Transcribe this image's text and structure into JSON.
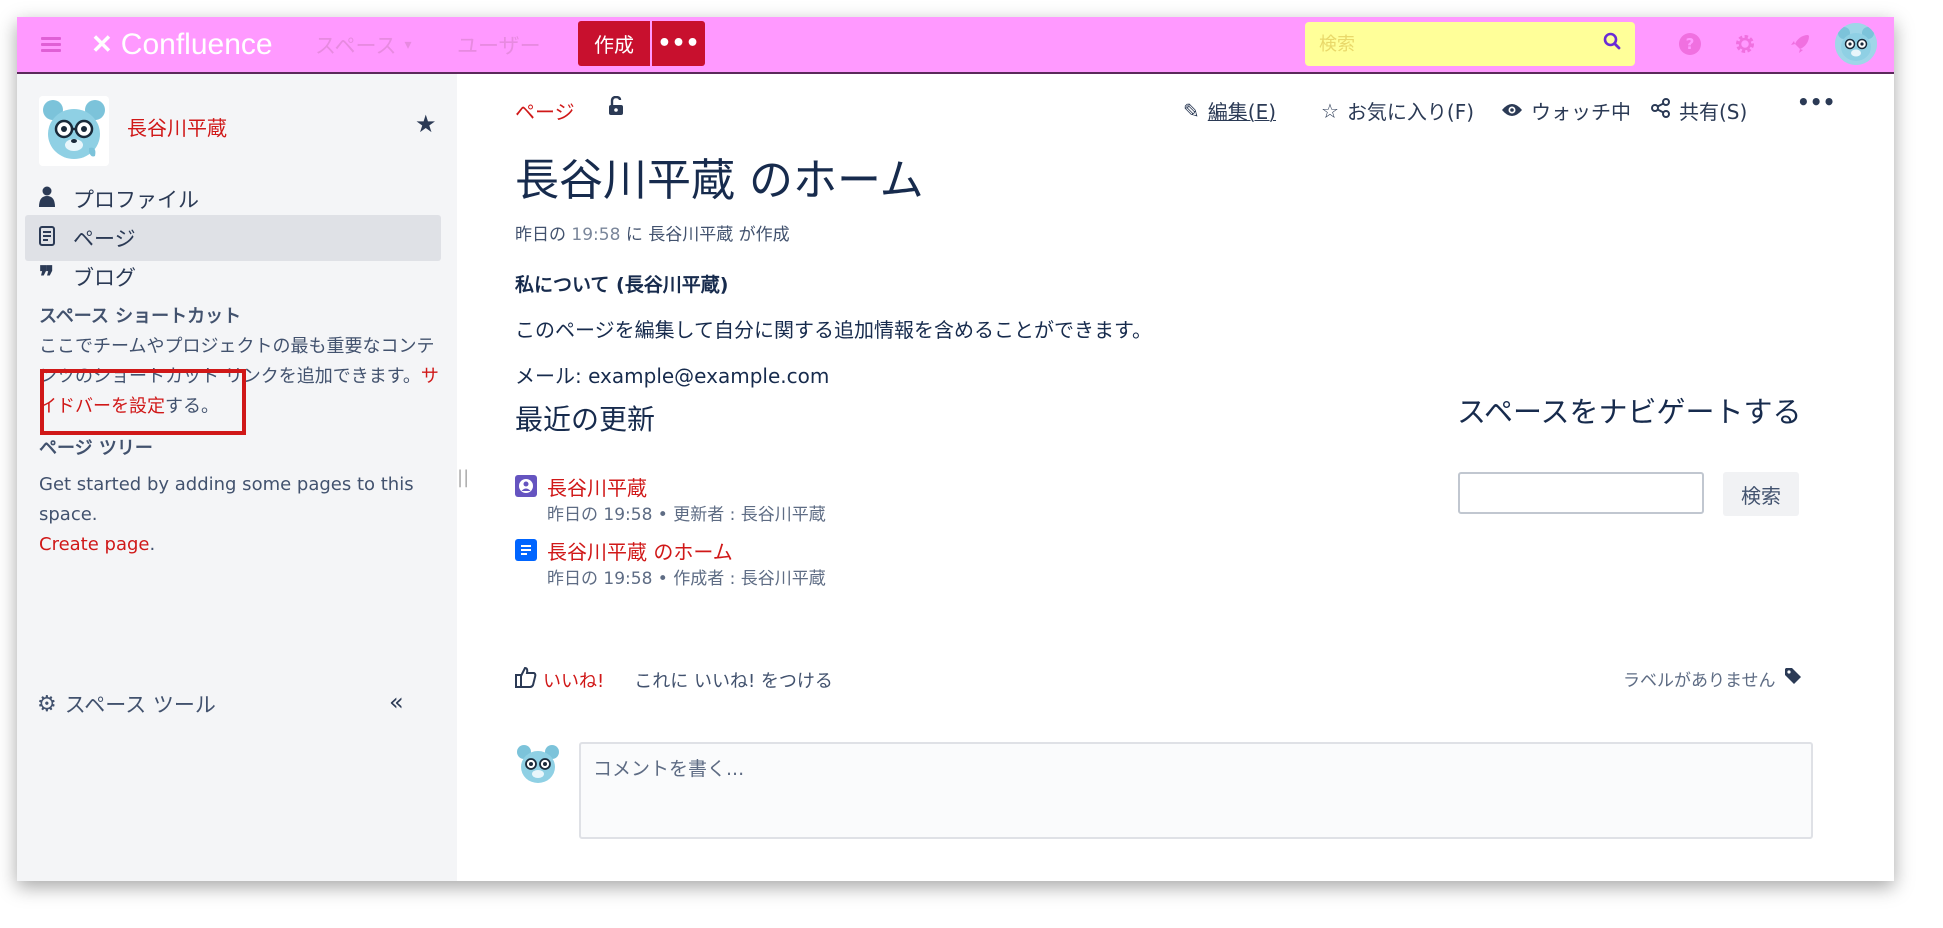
{
  "topbar": {
    "logo_text": "Confluence",
    "nav_spaces": "スペース",
    "nav_users": "ユーザー",
    "create_label": "作成",
    "more_label": "•••",
    "search_placeholder": "検索",
    "accent_color": "#ff99ff",
    "create_color": "#c8102e"
  },
  "sidebar": {
    "space_name": "長谷川平蔵",
    "nav": [
      {
        "label": "プロファイル",
        "icon": "person-icon"
      },
      {
        "label": "ページ",
        "icon": "page-icon"
      },
      {
        "label": "ブログ",
        "icon": "quote-icon"
      }
    ],
    "shortcuts_heading": "スペース ショートカット",
    "shortcuts_text_1": "ここでチームやプロジェクトの最も重要なコンテンツのショートカット リンクを追加できます。",
    "shortcuts_link": "サイドバーを設定",
    "shortcuts_text_2": "する。",
    "tree_heading": "ページ ツリー",
    "tree_text": "Get started by adding some pages to this space.",
    "tree_link": "Create page",
    "tree_period": ".",
    "tools_label": "スペース ツール",
    "collapse_label": "«"
  },
  "page": {
    "breadcrumb": "ページ",
    "actions": {
      "edit": "編集(E)",
      "favorite": "お気に入り(F)",
      "watch": "ウォッチ中",
      "share": "共有(S)",
      "more": "•••"
    },
    "title": "長谷川平蔵 のホーム",
    "byline_prefix": "昨日の",
    "byline_time": "19:58",
    "byline_suffix": "に 長谷川平蔵 が作成",
    "about_heading": "私について (長谷川平蔵)",
    "para1": "このページを編集して自分に関する追加情報を含めることができます。",
    "para2": "メール: example@example.com",
    "recent_heading": "最近の更新",
    "recent": [
      {
        "title": "長谷川平蔵",
        "meta": "昨日の 19:58 • 更新者 : 長谷川平蔵",
        "icon": "profile-icon",
        "color": "#6554c0"
      },
      {
        "title": "長谷川平蔵 のホーム",
        "meta": "昨日の 19:58 • 作成者 : 長谷川平蔵",
        "icon": "document-icon",
        "color": "#0065ff"
      }
    ],
    "nav_heading": "スペースをナビゲートする",
    "nav_search_button": "検索",
    "like_label": "いいね!",
    "like_prompt": "これに いいね! をつける",
    "no_labels": "ラベルがありません",
    "comment_placeholder": "コメントを書く..."
  }
}
